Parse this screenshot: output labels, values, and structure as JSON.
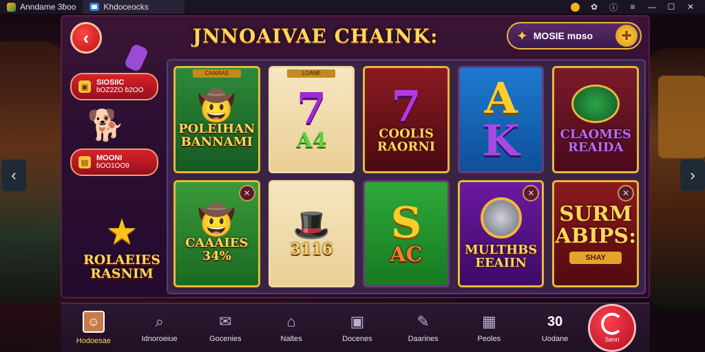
{
  "titlebar": {
    "app_title": "Anndame 3ɓoo",
    "tab_label": "Khdoceocks",
    "controls": [
      "coin-icon",
      "gamepad-icon",
      "info-icon",
      "menu-icon",
      "minimize-icon",
      "maximize-icon",
      "close-icon"
    ]
  },
  "header": {
    "title": "JNNOAIVAE CHAINK:",
    "mode_label": "MOSIE mɒso"
  },
  "sidebar": {
    "pill1_line1": "SIOSIIC",
    "pill1_line2": "ɓOZ2ZO ɓ2OO",
    "pill2_line1": "MOONI",
    "pill2_line2": "ɓOO1OO9",
    "promo_text": "ROLAEIES RASNIM"
  },
  "tiles": [
    {
      "label": "POLEIHAN BANNAMI",
      "badge": "CAAIAAS"
    },
    {
      "big": "7",
      "label": "A4",
      "badge": "LOANE"
    },
    {
      "big": "7",
      "label": "COOLIS RAORNI"
    },
    {
      "big": "A",
      "label": "K"
    },
    {
      "label": "CLAOMES REAIDA"
    },
    {
      "label": "CAAAIES 34%"
    },
    {
      "label": "3116"
    },
    {
      "big": "S",
      "label": "AC"
    },
    {
      "label": "MULTHBS EEAIIN"
    },
    {
      "label": "SURM ABIPS:",
      "button": "SHAY"
    }
  ],
  "bottom_nav": [
    {
      "label": "Hodoesae",
      "icon": "avatar-icon"
    },
    {
      "label": "Idnoroeiue",
      "icon": "search-icon"
    },
    {
      "label": "Gocenies",
      "icon": "inbox-icon"
    },
    {
      "label": "Naltes",
      "icon": "home-icon"
    },
    {
      "label": "Docenes",
      "icon": "wallet-icon"
    },
    {
      "label": "Daarines",
      "icon": "tools-icon"
    },
    {
      "label": "Peoles",
      "icon": "table-icon"
    },
    {
      "label": "Uodane",
      "icon_text": "30"
    }
  ],
  "spin": {
    "label": "Senn"
  },
  "colors": {
    "accent_gold": "#ffd75a",
    "accent_red": "#d8212a",
    "panel": "#2b0f33"
  }
}
